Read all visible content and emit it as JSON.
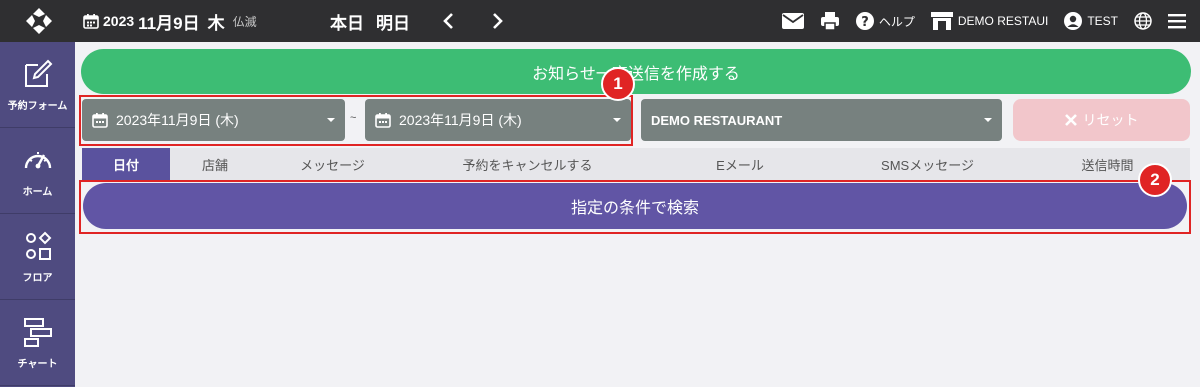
{
  "topbar": {
    "year": "2023",
    "month_day": "11月9日",
    "weekday": "木",
    "rokuyo": "仏滅",
    "today": "本日",
    "tomorrow": "明日",
    "help": "ヘルプ",
    "restaurant": "DEMO RESTAUI",
    "user": "TEST"
  },
  "sidebar": {
    "items": [
      {
        "label": "予約フォーム",
        "icon": "edit-icon"
      },
      {
        "label": "ホーム",
        "icon": "gauge-icon"
      },
      {
        "label": "フロア",
        "icon": "shapes-icon"
      },
      {
        "label": "チャート",
        "icon": "chart-icon"
      }
    ]
  },
  "main": {
    "notice_button": "お知らせ一斉送信を作成する",
    "date_from": "2023年11月9日 (木)",
    "date_separator": "~",
    "date_to": "2023年11月9日 (木)",
    "restaurant_select": "DEMO RESTAURANT",
    "reset_button": "リセット",
    "tabs": [
      "日付",
      "店舗",
      "メッセージ",
      "予約をキャンセルする",
      "Eメール",
      "SMSメッセージ",
      "送信時間"
    ],
    "search_button": "指定の条件で検索"
  },
  "callouts": [
    "1",
    "2"
  ],
  "colors": {
    "topbar": "#2f2f31",
    "sidebar": "#4f4b80",
    "green": "#3dbd74",
    "purple": "#6155a5",
    "callout": "#e02424"
  }
}
